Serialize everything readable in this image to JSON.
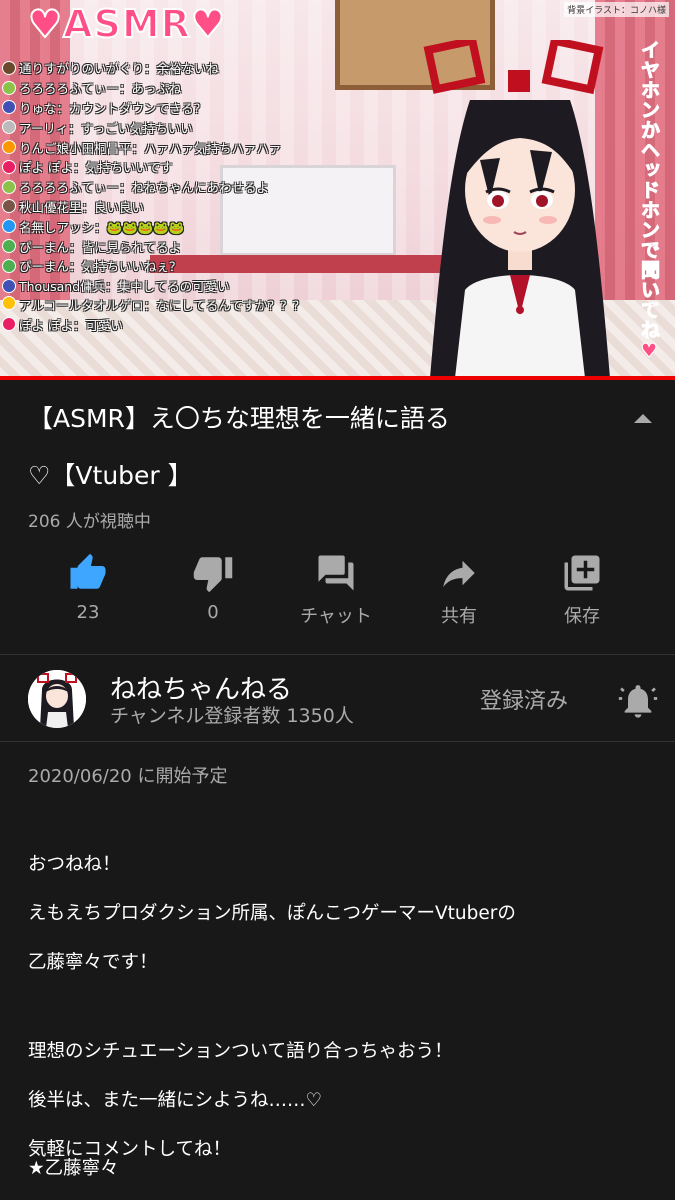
{
  "video": {
    "asmr_title": "♥ASMR♥",
    "bg_credit": "背景イラスト：コノハ様",
    "vertical_note": "イヤホンかヘッドホンで聞いてね♥",
    "chat": [
      {
        "name": "通りすがりのいがぐり",
        "text": "余裕ないね",
        "color": "#6b4a2b"
      },
      {
        "name": "ろろろろふてぃー",
        "text": "あっぷね",
        "color": "#8bc34a"
      },
      {
        "name": "りゅな",
        "text": "カウントダウンできる？",
        "color": "#3f51b5"
      },
      {
        "name": "アーリィ",
        "text": "すっごい気持ちいい",
        "color": "#bbb"
      },
      {
        "name": "りんご娘小田桐昌平",
        "text": "ハァハァ気持ちハァハァ",
        "color": "#ff9800"
      },
      {
        "name": "ぽよ ぽよ",
        "text": "気持ちいいです",
        "color": "#e91e63"
      },
      {
        "name": "ろろろろふてぃー",
        "text": "ねねちゃんにあわせるよ",
        "color": "#8bc34a"
      },
      {
        "name": "秋山優花里",
        "text": "良い良い",
        "color": "#795548"
      },
      {
        "name": "名無しアッシ",
        "text": "🐸🐸🐸🐸🐸",
        "color": "#2196f3"
      },
      {
        "name": "ぴーまん",
        "text": "皆に見られてるよ",
        "color": "#4caf50"
      },
      {
        "name": "ぴーまん",
        "text": "気持ちいいねぇ？",
        "color": "#4caf50"
      },
      {
        "name": "Thousand傭兵",
        "text": "集中してるの可愛い",
        "color": "#3f51b5"
      },
      {
        "name": "アルコールタオルゲロ",
        "text": "なにしてるんですか？？？",
        "color": "#ffc107"
      },
      {
        "name": "ぽよ ぽよ",
        "text": "可愛い",
        "color": "#e91e63"
      }
    ]
  },
  "info": {
    "title_line1": "【ASMR】え〇ちな理想を一緒に語る",
    "title_line2": "♡【Vtuber 】",
    "viewers": "206 人が視聴中"
  },
  "actions": {
    "like_count": "23",
    "dislike_count": "0",
    "chat_label": "チャット",
    "share_label": "共有",
    "save_label": "保存"
  },
  "channel": {
    "name": "ねねちゃんねる",
    "subscribers": "チャンネル登録者数 1350人",
    "subscribed_label": "登録済み"
  },
  "description": {
    "scheduled": "2020/06/20 に開始予定",
    "p1": [
      "おつねね！",
      "えもえちプロダクション所属、ぽんこつゲーマーVtuberの",
      "乙藤寧々です！"
    ],
    "p2": [
      "理想のシチュエーションついて語り合っちゃおう！",
      "後半は、また一緒にシようね……♡",
      "気軽にコメントしてね！"
    ],
    "sign": "★乙藤寧々"
  },
  "colors": {
    "accent_like": "#3ea6ff",
    "live_red": "#e00000",
    "background": "#181818"
  }
}
